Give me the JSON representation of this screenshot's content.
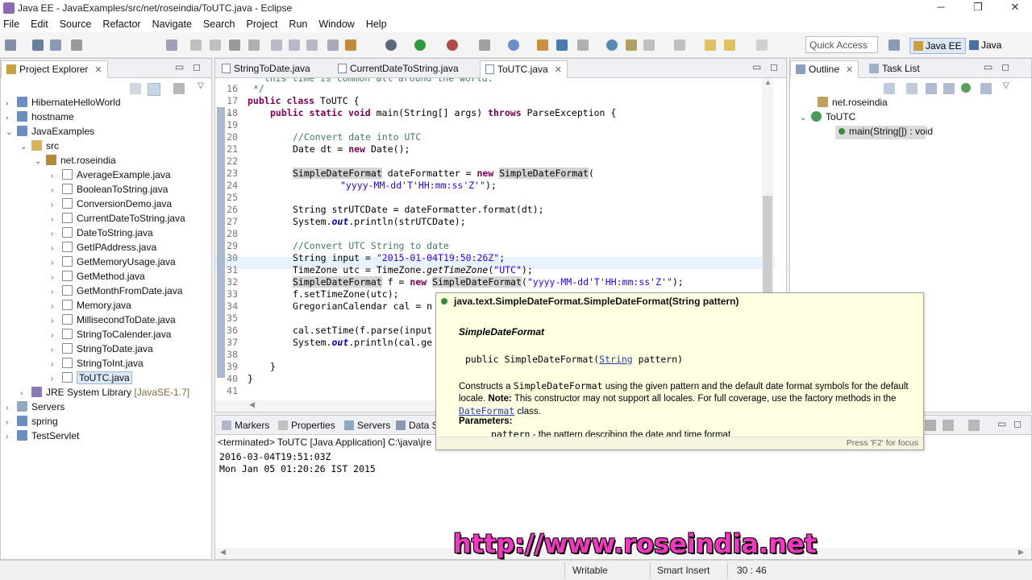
{
  "window": {
    "title": "Java EE - JavaExamples/src/net/roseindia/ToUTC.java - Eclipse",
    "controls": [
      "─",
      "❐",
      "✕"
    ]
  },
  "menu": [
    "File",
    "Edit",
    "Source",
    "Refactor",
    "Navigate",
    "Search",
    "Project",
    "Run",
    "Window",
    "Help"
  ],
  "toolbar": {
    "quick_access": "Quick Access",
    "perspectives": [
      "Java EE",
      "Java"
    ]
  },
  "project_explorer": {
    "title": "Project Explorer",
    "items": [
      {
        "label": "HibernateHelloWorld",
        "kind": "project"
      },
      {
        "label": "hostname",
        "kind": "project"
      },
      {
        "label": "JavaExamples",
        "kind": "project"
      },
      {
        "label": "src",
        "kind": "folder"
      },
      {
        "label": "net.roseindia",
        "kind": "package"
      },
      {
        "label": "AverageExample.java",
        "kind": "java"
      },
      {
        "label": "BooleanToString.java",
        "kind": "java"
      },
      {
        "label": "ConversionDemo.java",
        "kind": "java"
      },
      {
        "label": "CurrentDateToString.java",
        "kind": "java"
      },
      {
        "label": "DateToString.java",
        "kind": "java"
      },
      {
        "label": "GetIPAddress.java",
        "kind": "java"
      },
      {
        "label": "GetMemoryUsage.java",
        "kind": "java"
      },
      {
        "label": "GetMethod.java",
        "kind": "java"
      },
      {
        "label": "GetMonthFromDate.java",
        "kind": "java"
      },
      {
        "label": "Memory.java",
        "kind": "java"
      },
      {
        "label": "MillisecondToDate.java",
        "kind": "java"
      },
      {
        "label": "StringToCalender.java",
        "kind": "java"
      },
      {
        "label": "StringToDate.java",
        "kind": "java"
      },
      {
        "label": "StringToInt.java",
        "kind": "java"
      },
      {
        "label": "ToUTC.java",
        "kind": "java"
      },
      {
        "label": "JRE System Library",
        "suffix": "[JavaSE-1.7]",
        "kind": "library"
      },
      {
        "label": "Servers",
        "kind": "project"
      },
      {
        "label": "spring",
        "kind": "project"
      },
      {
        "label": "TestServlet",
        "kind": "project"
      }
    ]
  },
  "editor": {
    "tabs": [
      "StringToDate.java",
      "CurrentDateToString.java",
      "ToUTC.java"
    ],
    "top_partial": "   this time is common all around the world.",
    "lines": {
      "l16": {
        "n": "16",
        "t": " */"
      },
      "l17": {
        "n": "17"
      },
      "l18": {
        "n": "18"
      },
      "l19": {
        "n": "19"
      },
      "l20": {
        "n": "20"
      },
      "l21": {
        "n": "21"
      },
      "l22": {
        "n": "22"
      },
      "l23": {
        "n": "23"
      },
      "l24": {
        "n": "24"
      },
      "l25": {
        "n": "25"
      },
      "l26": {
        "n": "26"
      },
      "l27": {
        "n": "27"
      },
      "l28": {
        "n": "28"
      },
      "l29": {
        "n": "29"
      },
      "l30": {
        "n": "30"
      },
      "l31": {
        "n": "31"
      },
      "l32": {
        "n": "32"
      },
      "l33": {
        "n": "33"
      },
      "l34": {
        "n": "34"
      },
      "l35": {
        "n": "35"
      },
      "l36": {
        "n": "36"
      },
      "l37": {
        "n": "37"
      },
      "l38": {
        "n": "38"
      },
      "l39": {
        "n": "39"
      },
      "l40": {
        "n": "40"
      },
      "l41": {
        "n": "41"
      }
    },
    "tokens": {
      "public": "public",
      "class": "class",
      "static": "static",
      "void": "void",
      "throws": "throws",
      "new": "new",
      "class_name": " ToUTC {",
      "main_sig": " main(String[] args) ",
      "exc": " ParseException {",
      "c20": "//Convert date into UTC",
      "l21a": "Date dt = ",
      "l21b": " Date();",
      "sdf": "SimpleDateFormat",
      "l23a": " dateFormatter = ",
      "l23b": "(",
      "l24s": "\"yyyy-MM-dd'T'HH:mm:ss'Z'\"",
      "l24e": ");",
      "l26": "String strUTCDate = dateFormatter.format(dt);",
      "l27a": "System.",
      "out": "out",
      "l27b": ".println(strUTCDate);",
      "c29": "//Convert UTC String to date",
      "l30a": "String input = ",
      "l30s": "\"2015-01-04T19:50:26Z\"",
      "l30e": ";",
      "l31a": "TimeZone utc = TimeZone.",
      "l31m": "getTimeZone",
      "l31b": "(",
      "l31s": "\"UTC\"",
      "l31e": ");",
      "l32a": " f = ",
      "l32s": "\"yyyy-MM-dd'T'HH:mm:ss'Z'\"",
      "l32e": ");",
      "l33": "f.setTimeZone(utc);",
      "l34": "GregorianCalendar cal = n",
      "l36": "cal.setTime(f.parse(input",
      "l37a": "System.",
      "l37b": ".println(cal.ge",
      "l39": "}",
      "l40": "}"
    }
  },
  "javadoc": {
    "header": "java.text.SimpleDateFormat.SimpleDateFormat(String pattern)",
    "name": "SimpleDateFormat",
    "sig_a": "public SimpleDateFormat(",
    "sig_link": "String",
    "sig_b": " pattern)",
    "desc_a": "Constructs a ",
    "desc_code": "SimpleDateFormat",
    "desc_b": " using the given pattern and the default date format symbols for the default locale. ",
    "note": "Note:",
    "desc_c": " This constructor may not support all locales. For full coverage, use the factory methods in the ",
    "desc_link": "DateFormat",
    "desc_d": " class.",
    "params_label": "Parameters:",
    "param_name": "pattern",
    "param_desc": " - the pattern describing the date and time format",
    "footer": "Press 'F2' for focus"
  },
  "outline": {
    "tabs": [
      "Outline",
      "Task List"
    ],
    "items": [
      "net.roseindia",
      "ToUTC",
      "main(String[]) : void"
    ]
  },
  "bottom_panel": {
    "tabs": [
      "Markers",
      "Properties",
      "Servers",
      "Data S"
    ],
    "status": "<terminated> ToUTC [Java Application] C:\\java\\jre",
    "output": [
      "2016-03-04T19:51:03Z",
      "Mon Jan 05 01:20:26 IST 2015"
    ]
  },
  "statusbar": {
    "writable": "Writable",
    "insert_mode": "Smart Insert",
    "position": "30 : 46"
  },
  "watermark": "http://www.roseindia.net"
}
